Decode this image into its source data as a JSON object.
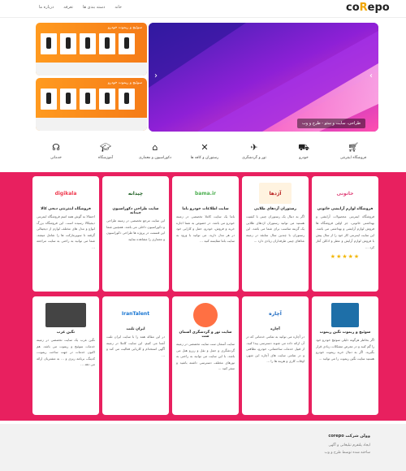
{
  "header": {
    "logo_a": "co",
    "logo_b": "R",
    "logo_c": "epo",
    "nav": [
      "خانه",
      "دسته بندی ها",
      "تعرفه",
      "درباره ما"
    ]
  },
  "slider": {
    "caption": "طراحی، سایت و سئو - طرح و وب"
  },
  "ads": [
    {
      "title": "سوئیچ و ریموت خودرو"
    },
    {
      "title": "سوئیچ و ریموت خودرو"
    }
  ],
  "categories": [
    {
      "label": "فروشگاه اینترنتی",
      "icon": "cart-icon"
    },
    {
      "label": "خودرو",
      "icon": "car-icon"
    },
    {
      "label": "تور و گردشگری",
      "icon": "plane-icon"
    },
    {
      "label": "رستوران و کافه ها",
      "icon": "cutlery-icon"
    },
    {
      "label": "دکوراسیون و معماری",
      "icon": "building-icon"
    },
    {
      "label": "آموزشگاه",
      "icon": "graduation-icon"
    },
    {
      "label": "خدماتی",
      "icon": "headset-icon"
    }
  ],
  "cards": [
    {
      "title": "فروشگاه لوازم آرایشی خاتونی",
      "logo": "خاتونی",
      "desc": "فروشگاه اینترنتی محصولات آرایشی و بهداشتی خاتونی، جز اولین فروشگاه ها فروش لوازم آرایشی و بهداشتی می باشد. این سایت اینترنتی کار خود را از سال پیش با فروش لوازم آرایش و عطر و ادکلن آغاز کرد ...",
      "stars": "★★★★★"
    },
    {
      "title": "رستوران آژدهای طلایی",
      "logo": "آژدها",
      "desc": "اگر به دنبال یک رستوران چینی با کیفیت هستید می توانید رستوران اژدهای طلایی یک گزینه مناسب برای شما می باشد. این رستوران با چندین سال سابقه در زمینه غذاهای چینی طرفداران زیادی دارد ..."
    },
    {
      "title": "سایت اطلاعات خودرو باما",
      "logo": "bama.ir",
      "desc": "باما یک سایت کاملا تخصصی در زمینه خودرو می باشد. در خصوص به شما اجازه خرید و فروش، خودرو، حمل و کارایی خود در هر مدل دارید. می توانید با ورود به سایت باما مقایسه کنید ..."
    },
    {
      "title": "سایت طراحی دکوراسیون چیدانه",
      "logo": "چیدانه",
      "desc": "این سایت مرجع تخصصی در زمینه طراحی و دکوراسیون داخلی می باشد. همچنین شما این قسمت در پروژه ها طراحی دکوراسیون و معماری را مشاهده نمایید"
    },
    {
      "title": "فروشگاه اینترنتی دیجی کالا",
      "logo": "digikala",
      "desc": "احتمالا به گوش همه اسم فروشگاه اینترنتی دیجیکالا رسیده است. این فروشگاه بزرگ انواع و مدل های مختلف لوازم از دیجیتالی گرفته تا سوپرمارکت ها را شامل میشه. شما می توانید به راحتی به سایت مراجعه ..."
    },
    {
      "title": "سوئیچ و ریموت نگین ریموت",
      "logo": "",
      "desc": "اگر بخاطر هرگونه دلیلی سوئیچ خودرو خود را گم کنید و در معرض مشکلات زیادی قرار بگیرید. اگر به دنبال خرید ریموت خودرو هستید سایت نگین ریموت را می توانید ..."
    },
    {
      "title": "آچاره",
      "logo": "آچاره",
      "desc": "در آچاره می توانید به تمامی خدماتی که در آن ارائه داده می شوند دسترسی پیدا کنید. از قبیل خدمات ساختمانی، خودرو، نظافتی و در تمامی سایت های آچاره این شهر، اوقات کاری و هزینه ها را ..."
    },
    {
      "title": "سایت تور و گردشگری آسمان ست",
      "logo": "",
      "desc": "سایت آسمان ست سایت تخصصی در زمینه گردشگری و حمل و نقل و رزرو هتل می باشد. با این سایت می توانید به راحتی به تورهای مختلف دسترسی داشته باشید و سفر کنید ..."
    },
    {
      "title": "ایران تلنت",
      "logo": "IranTalent",
      "desc": "در این مقاله همه را با سایت ایران تلنت آشنا می کنیم. این سایت کاملا در زمینه آگهی استخدام و کاریابی فعالیت می کند و ..."
    },
    {
      "title": "نگین غرب",
      "logo": "",
      "desc": "نگین غرب یک سایت تخصصی در زمینه خدمات سوئیچ و ریموت می باشد. هم اکنون خدمات در جهت ساخت ریموت، کدینگ، برنامه ریزی و ... به مشتریان ارائه می دهد ..."
    }
  ],
  "footer": {
    "title": "وولن شرکت corepo",
    "lines": [
      "ایجاد پلتفرم تبلیغاتی و آگهی",
      "ساخته شده توسط طرح و وب"
    ]
  },
  "colors": {
    "accent": "#e8205f",
    "ad": "#f57b18",
    "slider": "#7a1fd0"
  }
}
